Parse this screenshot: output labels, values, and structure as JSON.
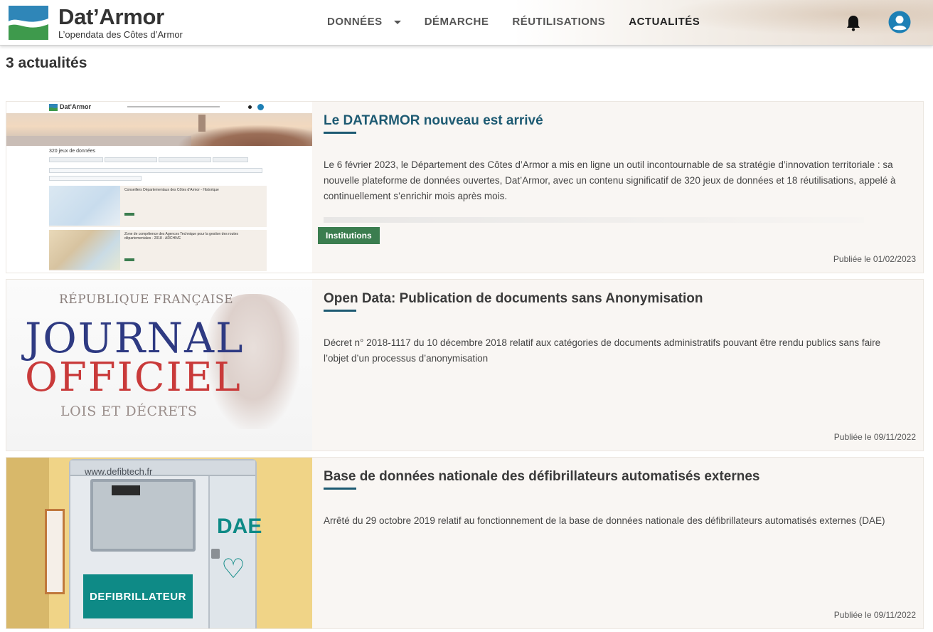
{
  "header": {
    "brand_name": "Dat’Armor",
    "brand_tagline": "L’opendata des Côtes d’Armor",
    "nav": [
      {
        "label": "DONNÉES",
        "has_dropdown": true
      },
      {
        "label": "DÉMARCHE"
      },
      {
        "label": "RÉUTILISATIONS"
      },
      {
        "label": "ACTUALITÉS",
        "active": true
      }
    ],
    "icons": [
      "bell-icon",
      "user-icon"
    ],
    "colors": {
      "logo_blue": "#2f86b8",
      "logo_green": "#3e9a4c",
      "user_icon": "#1e80b5"
    }
  },
  "list": {
    "count_label": "3 actualités"
  },
  "articles": [
    {
      "title": "Le DATARMOR nouveau est arrivé",
      "description": "Le 6 février 2023, le Département des Côtes d’Armor a mis en ligne un outil incontournable de sa stratégie d’innovation territoriale : sa nouvelle plateforme de données ouvertes, Dat’Armor, avec un contenu significatif de 320 jeux de données et 18 réutilisations, appelé à continuellement s’enrichir mois après mois.",
      "tag": "Institutions",
      "published": "Publiée le 01/02/2023",
      "image_preview": {
        "brand": "Dat’Armor",
        "dataset_count": "320 jeux de données",
        "card1_title": "Conseillers Départementaux des Côtes d’Armor - Historique",
        "card2_title": "Zone de compétence des Agences Technique pour la gestion des routes départementales - 2018 - ARCHIVE"
      }
    },
    {
      "title": "Open Data: Publication de documents sans Anonymisation",
      "description": "Décret n° 2018-1117 du 10 décembre 2018 relatif aux catégories de documents administratifs pouvant être rendu publics sans faire l’objet d’un processus d’anonymisation",
      "published": "Publiée le 09/11/2022",
      "image_text": {
        "line1": "RÉPUBLIQUE FRANÇAISE",
        "line2": "JOURNAL",
        "line3": "OFFICIEL",
        "line4": "LOIS ET DÉCRETS"
      }
    },
    {
      "title": "Base de données nationale des défibrillateurs automatisés externes",
      "description": "Arrêté du 29 octobre 2019 relatif au fonctionnement de la base de données nationale des défibrillateurs automatisés externes (DAE)",
      "published": "Publiée le 09/11/2022",
      "image_text": {
        "url": "www.defibtech.fr",
        "label": "DEFIBRILLATEUR",
        "door": "DAE"
      }
    }
  ]
}
